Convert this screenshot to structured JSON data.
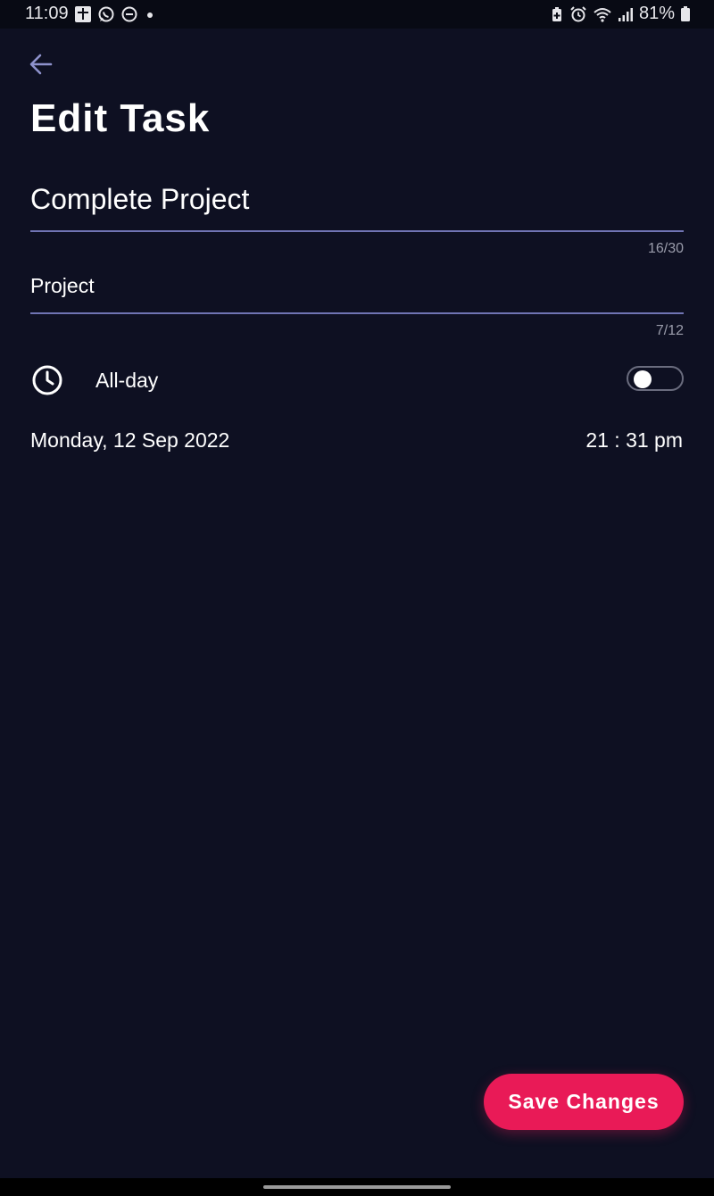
{
  "status_bar": {
    "time": "11:09",
    "battery": "81%",
    "left_icons": [
      "news-icon",
      "whatsapp-icon",
      "do-not-disturb-icon",
      "dot-icon"
    ],
    "right_icons": [
      "battery-saver-icon",
      "alarm-icon",
      "wifi-icon",
      "signal-icon",
      "battery-icon"
    ]
  },
  "header": {
    "back_icon": "arrow-left-icon",
    "title": "Edit Task"
  },
  "form": {
    "task_name": {
      "value": "Complete Project",
      "counter": "16/30"
    },
    "category": {
      "value": "Project",
      "counter": "7/12"
    },
    "all_day": {
      "label": "All-day",
      "icon": "clock-icon",
      "enabled": false
    },
    "date": "Monday, 12 Sep 2022",
    "time": "21 : 31 pm"
  },
  "actions": {
    "save_label": "Save Changes"
  },
  "colors": {
    "background": "#0e1022",
    "accent": "#e91a57",
    "underline": "#7074b4",
    "back_arrow": "#8e92cc"
  }
}
